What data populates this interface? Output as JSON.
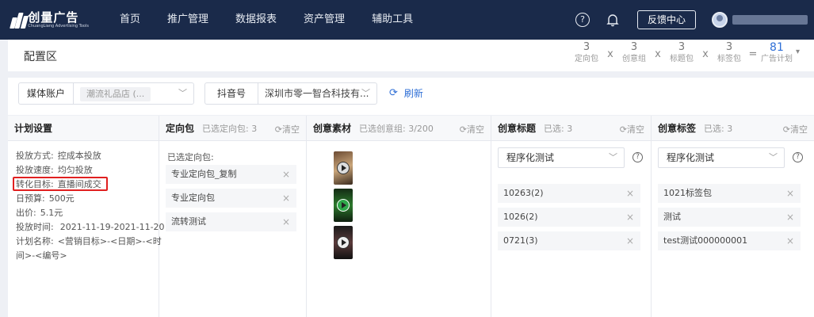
{
  "brand": {
    "name": "创量广告",
    "tagline": "ChuangLiang Advertising Tools"
  },
  "nav": {
    "items": [
      "首页",
      "推广管理",
      "数据报表",
      "资产管理",
      "辅助工具"
    ],
    "help_icon": "?",
    "feedback_label": "反馈中心"
  },
  "config": {
    "title": "配置区",
    "stats": [
      {
        "num": "3",
        "label": "定向包"
      },
      {
        "num": "3",
        "label": "创意组"
      },
      {
        "num": "3",
        "label": "标题包"
      },
      {
        "num": "3",
        "label": "标签包"
      }
    ],
    "op_multiply": "x",
    "op_equals": "=",
    "total": {
      "num": "81",
      "label": "广告计划"
    }
  },
  "filters": {
    "media_label": "媒体账户",
    "media_value": "潮流礼品店 (...",
    "douyin_label": "抖音号",
    "douyin_value": "深圳市零一智合科技有...",
    "refresh_label": "刷新"
  },
  "panels": {
    "clear_label": "清空",
    "plan": {
      "title": "计划设置",
      "rows": [
        {
          "k": "投放方式:",
          "v": "控成本投放"
        },
        {
          "k": "投放速度:",
          "v": "均匀投放"
        },
        {
          "k": "转化目标:",
          "v": "直播间成交"
        },
        {
          "k": "日预算:",
          "v": "500元"
        },
        {
          "k": "出价:",
          "v": "5.1元"
        },
        {
          "k": "投放时间:",
          "v": "2021-11-19-2021-11-20"
        },
        {
          "k": "计划名称:",
          "v": "<营销目标>-<日期>-<时"
        }
      ],
      "plan_name_cont": "间>-<编号>"
    },
    "directional": {
      "title": "定向包",
      "sub": "已选定向包: 3",
      "selected_label": "已选定向包:",
      "items": [
        "专业定向包_复制",
        "专业定向包",
        "流转测试"
      ]
    },
    "creative": {
      "title": "创意素材",
      "sub": "已选创意组: 3/200"
    },
    "titles": {
      "title": "创意标题",
      "sub": "已选: 3",
      "select_value": "程序化测试",
      "items": [
        "10263(2)",
        "1026(2)",
        "0721(3)"
      ]
    },
    "tags": {
      "title": "创意标签",
      "sub": "已选: 3",
      "select_value": "程序化测试",
      "items": [
        "1021标签包",
        "测试",
        "test测试000000001"
      ]
    }
  }
}
